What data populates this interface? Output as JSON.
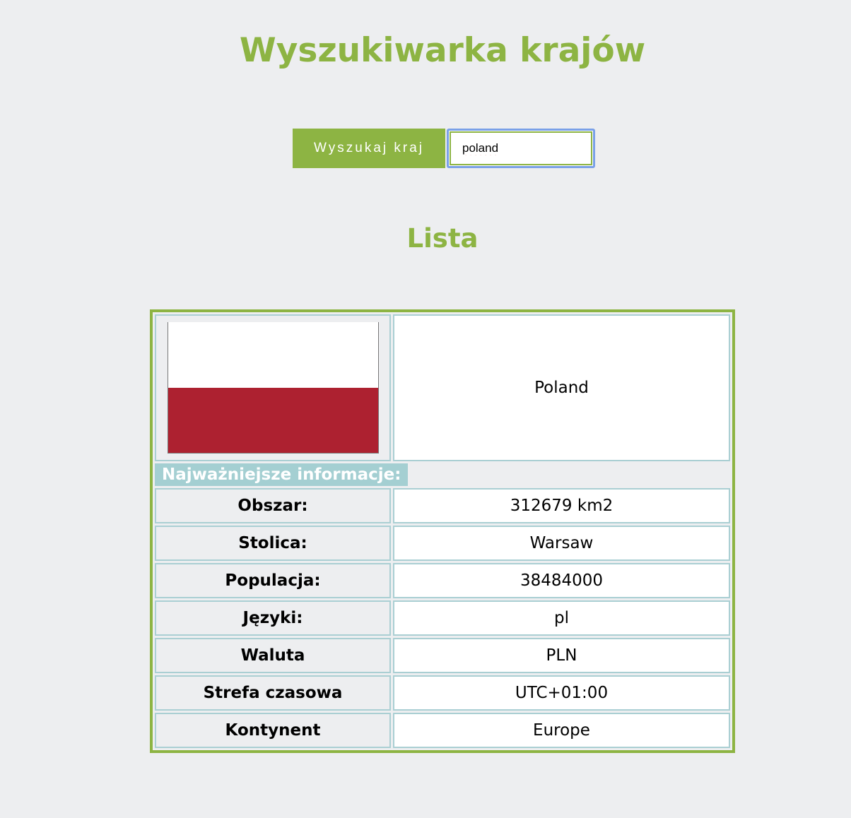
{
  "header": {
    "title": "Wyszukiwarka krajów"
  },
  "search": {
    "button_label": "Wyszukaj kraj",
    "input_value": "poland"
  },
  "list": {
    "title": "Lista"
  },
  "country": {
    "name": "Poland",
    "flag": {
      "icon": "poland-flag",
      "colors": [
        "#ffffff",
        "#ad2130"
      ]
    },
    "info_header": "Najważniejsze informacje:",
    "rows": [
      {
        "label": "Obszar:",
        "value": "312679 km2"
      },
      {
        "label": "Stolica:",
        "value": "Warsaw"
      },
      {
        "label": "Populacja:",
        "value": "38484000"
      },
      {
        "label": "Języki:",
        "value": "pl"
      },
      {
        "label": "Waluta",
        "value": "PLN"
      },
      {
        "label": "Strefa czasowa",
        "value": "UTC+01:00"
      },
      {
        "label": "Kontynent",
        "value": "Europe"
      }
    ]
  },
  "colors": {
    "accent": "#8db443",
    "background": "#edeef0",
    "cell_border": "#aacfd3",
    "info_header_bg": "#a4cfd2",
    "focus_ring": "#7aa0e8"
  }
}
